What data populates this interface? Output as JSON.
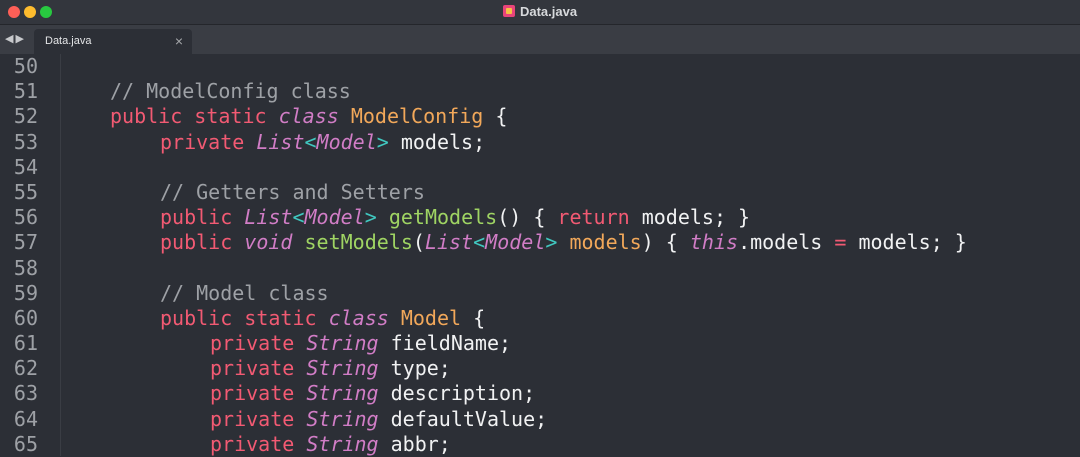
{
  "window": {
    "title": "Data.java"
  },
  "nav": {
    "back": "◀",
    "forward": "▶"
  },
  "tab": {
    "label": "Data.java",
    "close": "×"
  },
  "editor": {
    "lines": [
      {
        "n": "50",
        "indent": 0,
        "tokens": []
      },
      {
        "n": "51",
        "indent": 0,
        "tokens": [
          [
            "cm",
            "// ModelConfig class"
          ]
        ]
      },
      {
        "n": "52",
        "indent": 0,
        "tokens": [
          [
            "kw",
            "public static "
          ],
          [
            "it",
            "class "
          ],
          [
            "cls",
            "ModelConfig"
          ],
          [
            "pn",
            " {"
          ]
        ]
      },
      {
        "n": "53",
        "indent": 1,
        "tokens": [
          [
            "kw",
            "private "
          ],
          [
            "type",
            "List"
          ],
          [
            "gen",
            "<"
          ],
          [
            "type",
            "Model"
          ],
          [
            "gen",
            ">"
          ],
          [
            "id",
            " models;"
          ]
        ]
      },
      {
        "n": "54",
        "indent": 0,
        "tokens": []
      },
      {
        "n": "55",
        "indent": 1,
        "tokens": [
          [
            "cm",
            "// Getters and Setters"
          ]
        ]
      },
      {
        "n": "56",
        "indent": 1,
        "tokens": [
          [
            "kw",
            "public "
          ],
          [
            "type",
            "List"
          ],
          [
            "gen",
            "<"
          ],
          [
            "type",
            "Model"
          ],
          [
            "gen",
            ">"
          ],
          [
            "fn",
            " getModels"
          ],
          [
            "pn",
            "() { "
          ],
          [
            "kw",
            "return"
          ],
          [
            "id",
            " models; }"
          ]
        ]
      },
      {
        "n": "57",
        "indent": 1,
        "tokens": [
          [
            "kw",
            "public "
          ],
          [
            "it",
            "void"
          ],
          [
            "fn",
            " setModels"
          ],
          [
            "pn",
            "("
          ],
          [
            "type",
            "List"
          ],
          [
            "gen",
            "<"
          ],
          [
            "type",
            "Model"
          ],
          [
            "gen",
            ">"
          ],
          [
            "param",
            " models"
          ],
          [
            "pn",
            ") { "
          ],
          [
            "it",
            "this"
          ],
          [
            "id",
            ".models "
          ],
          [
            "op",
            "="
          ],
          [
            "id",
            " models; }"
          ]
        ]
      },
      {
        "n": "58",
        "indent": 0,
        "tokens": []
      },
      {
        "n": "59",
        "indent": 1,
        "tokens": [
          [
            "cm",
            "// Model class"
          ]
        ]
      },
      {
        "n": "60",
        "indent": 1,
        "tokens": [
          [
            "kw",
            "public static "
          ],
          [
            "it",
            "class "
          ],
          [
            "cls",
            "Model"
          ],
          [
            "pn",
            " {"
          ]
        ]
      },
      {
        "n": "61",
        "indent": 2,
        "tokens": [
          [
            "kw",
            "private "
          ],
          [
            "type",
            "String"
          ],
          [
            "id",
            " fieldName;"
          ]
        ]
      },
      {
        "n": "62",
        "indent": 2,
        "tokens": [
          [
            "kw",
            "private "
          ],
          [
            "type",
            "String"
          ],
          [
            "id",
            " type;"
          ]
        ]
      },
      {
        "n": "63",
        "indent": 2,
        "tokens": [
          [
            "kw",
            "private "
          ],
          [
            "type",
            "String"
          ],
          [
            "id",
            " description;"
          ]
        ]
      },
      {
        "n": "64",
        "indent": 2,
        "tokens": [
          [
            "kw",
            "private "
          ],
          [
            "type",
            "String"
          ],
          [
            "id",
            " defaultValue;"
          ]
        ]
      },
      {
        "n": "65",
        "indent": 2,
        "tokens": [
          [
            "kw",
            "private "
          ],
          [
            "type",
            "String"
          ],
          [
            "id",
            " abbr;"
          ]
        ]
      }
    ]
  },
  "colors": {
    "background": "#2c2f36",
    "keyword": "#f25a73",
    "type": "#d17dc6",
    "class_name": "#f2a85a",
    "function": "#9fd463",
    "comment": "#9ea1a6",
    "generic_bracket": "#40c8c0"
  }
}
